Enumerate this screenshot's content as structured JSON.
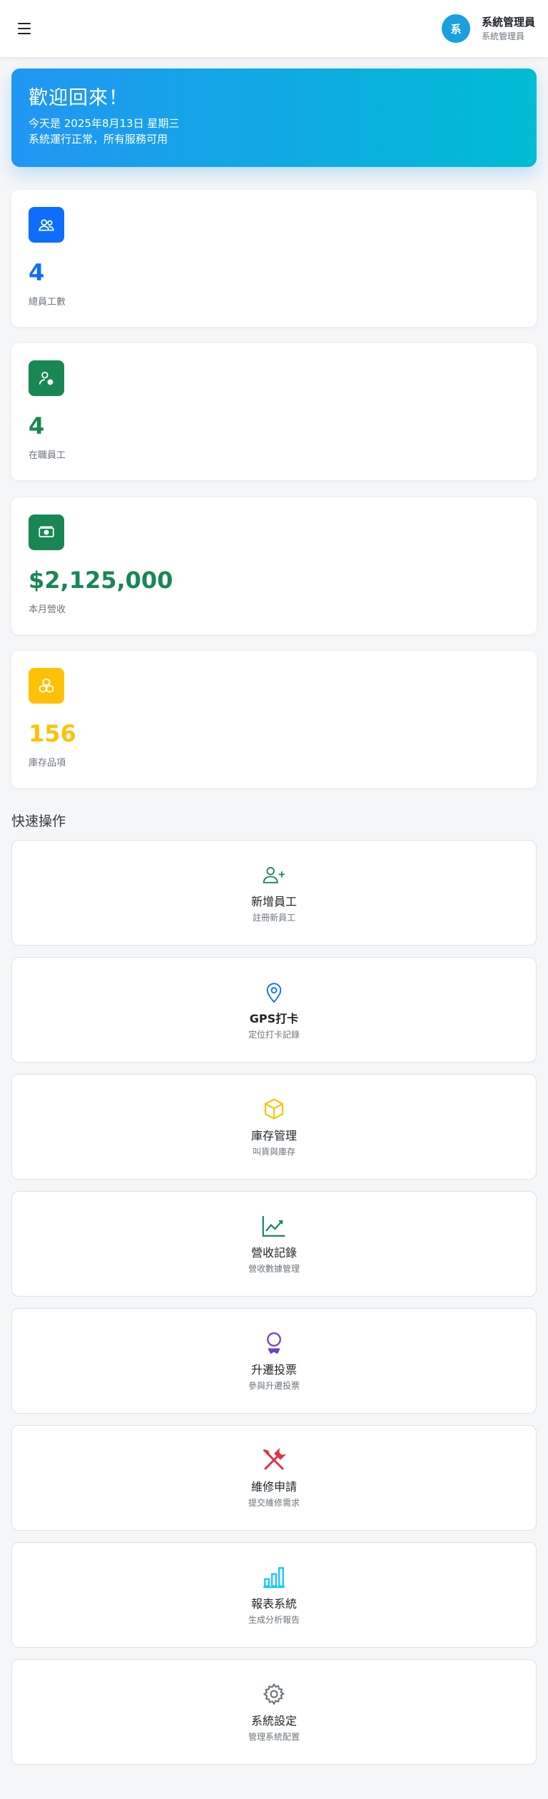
{
  "header": {
    "avatar_text": "系",
    "user_name": "系統管理員",
    "user_role": "系統管理員"
  },
  "welcome": {
    "title": "歡迎回來！",
    "date_line": "今天是 2025年8月13日 星期三",
    "status_line": "系統運行正常，所有服務可用"
  },
  "stats": [
    {
      "value": "4",
      "label": "總員工數",
      "icon": "people-icon",
      "color": "#0d6efd"
    },
    {
      "value": "4",
      "label": "在職員工",
      "icon": "person-check-icon",
      "color": "#198754"
    },
    {
      "value": "$2,125,000",
      "label": "本月營收",
      "icon": "cash-icon",
      "color": "#198754"
    },
    {
      "value": "156",
      "label": "庫存品項",
      "icon": "boxes-icon",
      "color": "#ffc107"
    }
  ],
  "quick_actions_title": "快速操作",
  "quick_actions": [
    {
      "title": "新增員工",
      "subtitle": "註冊新員工",
      "icon": "person-plus-icon",
      "color": "#198754"
    },
    {
      "title": "GPS打卡",
      "subtitle": "定位打卡記錄",
      "icon": "location-pin-icon",
      "color": "#0d6efd"
    },
    {
      "title": "庫存管理",
      "subtitle": "叫貨與庫存",
      "icon": "box-icon",
      "color": "#ffc107"
    },
    {
      "title": "營收記錄",
      "subtitle": "營收數據管理",
      "icon": "line-chart-icon",
      "color": "#198754"
    },
    {
      "title": "升遷投票",
      "subtitle": "參與升遷投票",
      "icon": "award-icon",
      "color": "#6f42c1"
    },
    {
      "title": "維修申請",
      "subtitle": "提交維修需求",
      "icon": "tools-icon",
      "color": "#dc3545"
    },
    {
      "title": "報表系統",
      "subtitle": "生成分析報告",
      "icon": "bar-chart-icon",
      "color": "#0dcaf0"
    },
    {
      "title": "系統設定",
      "subtitle": "管理系統配置",
      "icon": "gear-icon",
      "color": "#6c757d"
    }
  ]
}
